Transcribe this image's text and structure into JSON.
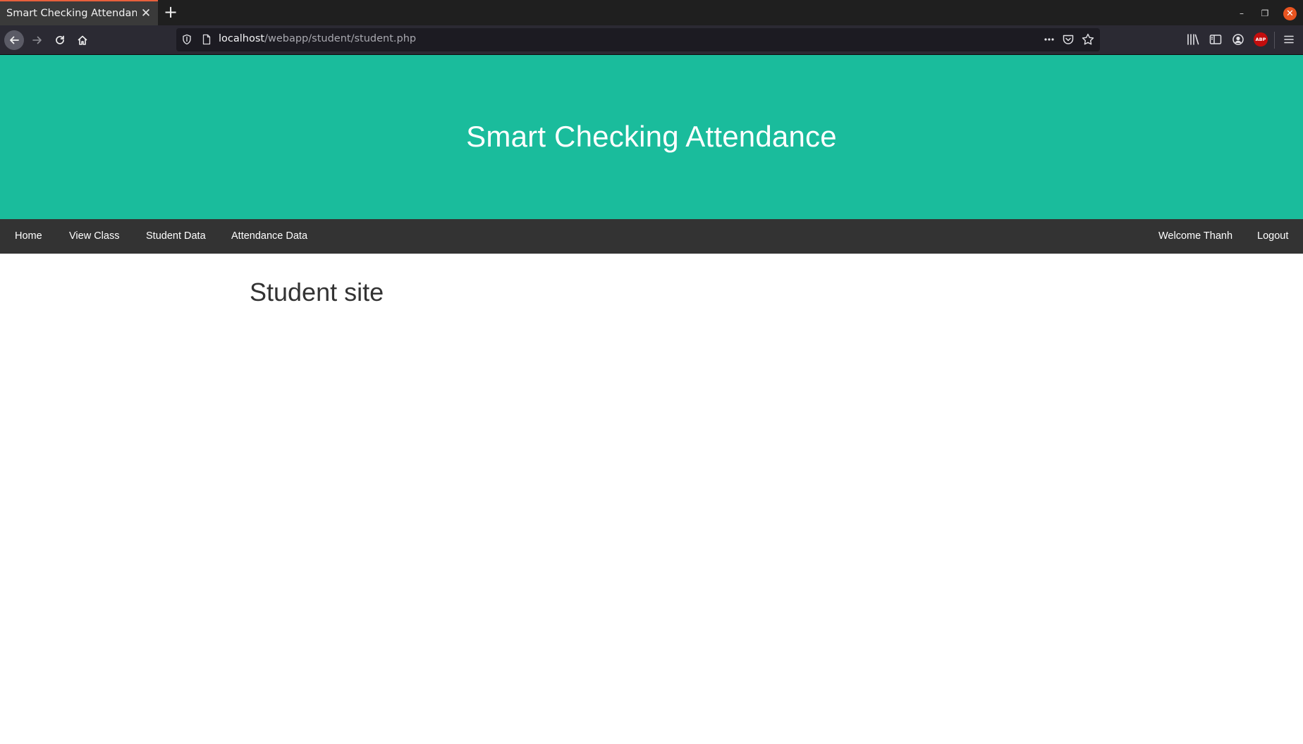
{
  "browser": {
    "tab": {
      "title": "Smart Checking Attendance"
    },
    "url": {
      "host": "localhost",
      "path": "/webapp/student/student.php"
    },
    "icons": {
      "back": "back-arrow-icon",
      "forward": "forward-arrow-icon",
      "reload": "reload-icon",
      "home": "home-icon",
      "shield": "shield-icon",
      "page": "page-icon",
      "more": "more-icon",
      "pocket": "pocket-icon",
      "bookmark": "star-icon",
      "library": "library-icon",
      "sidebar": "sidebar-icon",
      "account": "account-icon",
      "menu": "hamburger-menu-icon"
    },
    "abp_label": "ABP",
    "accent_color": "#e8603c"
  },
  "site": {
    "header": {
      "title": "Smart Checking Attendance",
      "background": "#1abc9c"
    },
    "nav": {
      "background": "#333333",
      "left_items": [
        "Home",
        "View Class",
        "Student Data",
        "Attendance Data"
      ],
      "welcome": "Welcome Thanh",
      "logout": "Logout"
    },
    "main": {
      "heading": "Student site"
    }
  }
}
